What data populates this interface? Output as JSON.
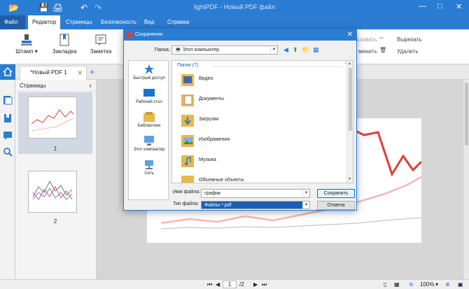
{
  "window": {
    "title": "lightPDF - Новый PDF файл"
  },
  "menu": {
    "file": "Файл",
    "tabs": [
      "Редактор",
      "Страницы",
      "Безопасность",
      "Вид",
      "Справка"
    ]
  },
  "ribbon": {
    "stamp": "Штамп",
    "bookmark": "Закладка",
    "note": "Заметка",
    "replace": "менить",
    "cut": "Вырезать",
    "delete": "Удалить",
    "edit_partial": "ьзовать"
  },
  "doc_tab": {
    "name": "*Новый PDF 1"
  },
  "pages_panel": {
    "title": "Страницы",
    "pages": [
      "1",
      "2"
    ]
  },
  "dialog": {
    "title": "Сохранение",
    "folder_label": "Папка:",
    "folder_value": "Этот компьютер",
    "places": [
      "Быстрый доступ",
      "Рабочий стол",
      "Библиотеки",
      "Этот компьютер",
      "Сеть"
    ],
    "group_header": "Папки (7)",
    "folders": [
      "Видео",
      "Документы",
      "Загрузки",
      "Изображения",
      "Музыка",
      "Объемные объекты"
    ],
    "filename_label": "Имя файла:",
    "filename_value": "график",
    "filetype_label": "Тип файла:",
    "filetype_value": "Файлы *.pdf",
    "save_button": "Сохранить",
    "cancel_button": "Отмена"
  },
  "status": {
    "current_page": "1",
    "total_pages": "/2",
    "zoom": "100%"
  },
  "colors": {
    "accent": "#2b7cd3",
    "chart_red": "#e23b3b",
    "chart_pink": "#f4b6b6"
  }
}
